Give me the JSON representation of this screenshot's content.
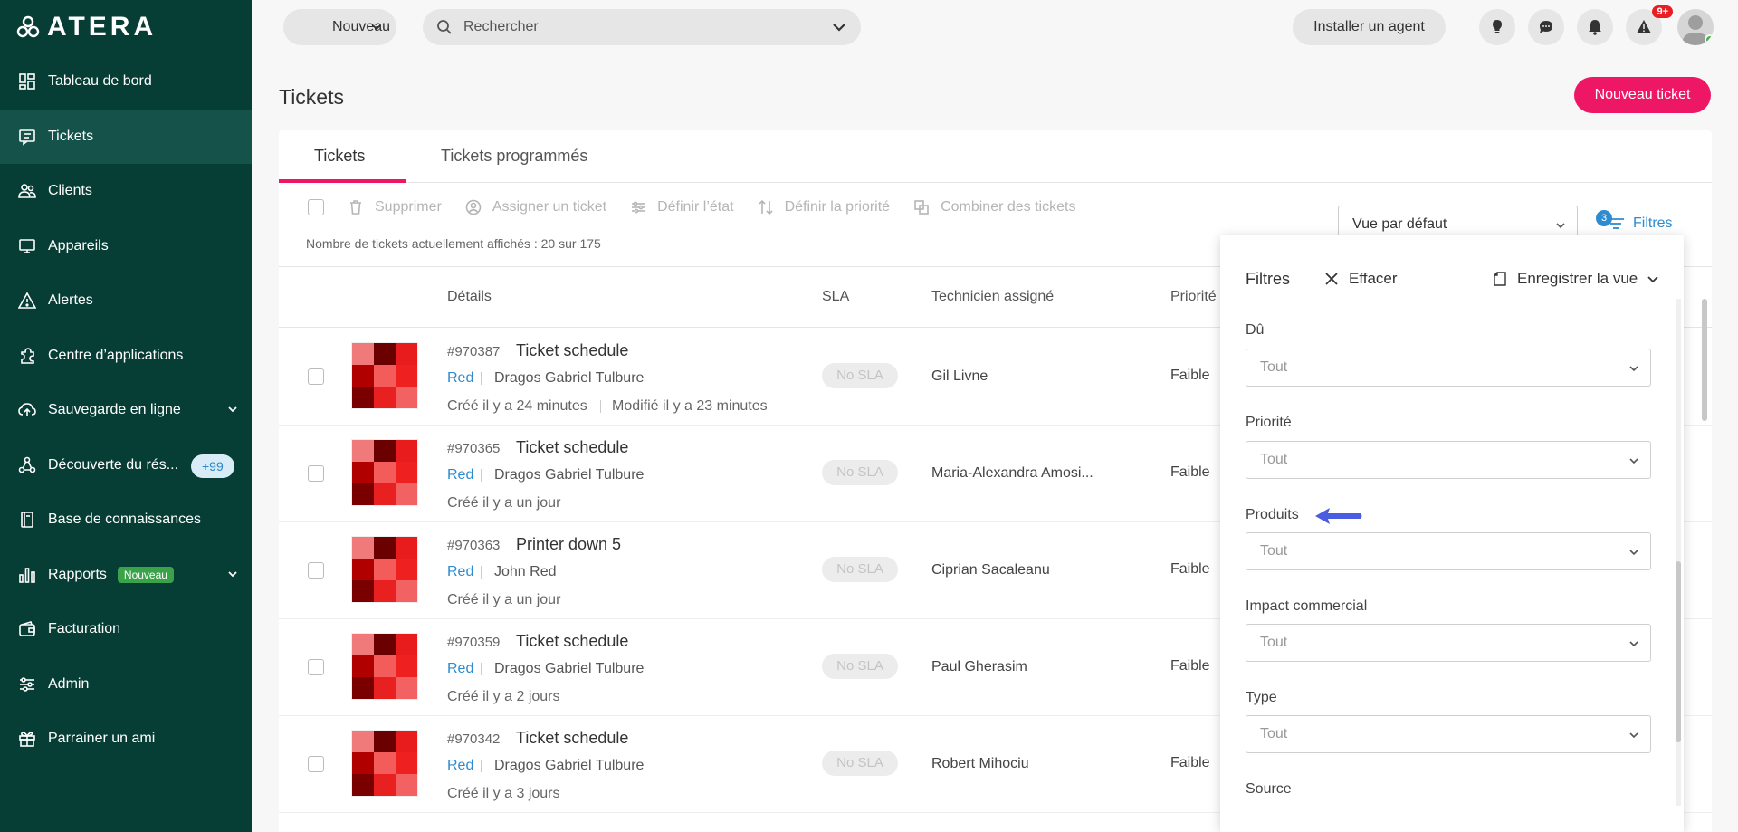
{
  "brand": {
    "logo_text": "ATERA"
  },
  "sidebar": {
    "items": [
      {
        "label": "Tableau de bord",
        "icon": "dashboard-icon"
      },
      {
        "label": "Tickets",
        "icon": "ticket-icon"
      },
      {
        "label": "Clients",
        "icon": "clients-icon"
      },
      {
        "label": "Appareils",
        "icon": "monitor-icon"
      },
      {
        "label": "Alertes",
        "icon": "alert-icon"
      },
      {
        "label": "Centre d’applications",
        "icon": "puzzle-icon"
      },
      {
        "label": "Sauvegarde en ligne",
        "icon": "cloud-icon"
      },
      {
        "label": "Découverte du rés...",
        "icon": "network-icon",
        "badge": "+99"
      },
      {
        "label": "Base de connaissances",
        "icon": "book-icon"
      },
      {
        "label": "Rapports",
        "icon": "chart-icon",
        "badge": "Nouveau"
      },
      {
        "label": "Facturation",
        "icon": "wallet-icon"
      },
      {
        "label": "Admin",
        "icon": "sliders-icon"
      },
      {
        "label": "Parrainer un ami",
        "icon": "gift-icon"
      }
    ]
  },
  "topbar": {
    "new_label": "Nouveau",
    "search_placeholder": "Rechercher",
    "install_label": "Installer un agent",
    "alerts_badge": "9+"
  },
  "page": {
    "title": "Tickets",
    "new_ticket_label": "Nouveau ticket"
  },
  "tabs": [
    {
      "label": "Tickets"
    },
    {
      "label": "Tickets programmés"
    }
  ],
  "toolbar": {
    "delete": "Supprimer",
    "assign": "Assigner un ticket",
    "state": "Définir l’état",
    "priority": "Définir la priorité",
    "combine": "Combiner des tickets",
    "count_text": "Nombre de tickets actuellement affichés : 20 sur 175",
    "view": "Vue par défaut",
    "filters_label": "Filtres",
    "filters_count": "3"
  },
  "table": {
    "headers": {
      "details": "Détails",
      "sla": "SLA",
      "tech": "Technicien assigné",
      "priority": "Priorité"
    },
    "rows": [
      {
        "id": "#970387",
        "title": "Ticket schedule",
        "client": "Red",
        "contact": "Dragos Gabriel Tulbure",
        "created": "Créé il y a 24 minutes",
        "modified": "Modifié il y a 23 minutes",
        "sla": "No SLA",
        "tech": "Gil Livne",
        "priority": "Faible"
      },
      {
        "id": "#970365",
        "title": "Ticket schedule",
        "client": "Red",
        "contact": "Dragos Gabriel Tulbure",
        "created": "Créé il y a un jour",
        "modified": "",
        "sla": "No SLA",
        "tech": "Maria-Alexandra Amosi...",
        "priority": "Faible"
      },
      {
        "id": "#970363",
        "title": "Printer down 5",
        "client": "Red",
        "contact": "John Red",
        "created": "Créé il y a un jour",
        "modified": "",
        "sla": "No SLA",
        "tech": "Ciprian Sacaleanu",
        "priority": "Faible"
      },
      {
        "id": "#970359",
        "title": "Ticket schedule",
        "client": "Red",
        "contact": "Dragos Gabriel Tulbure",
        "created": "Créé il y a 2 jours",
        "modified": "",
        "sla": "No SLA",
        "tech": "Paul Gherasim",
        "priority": "Faible"
      },
      {
        "id": "#970342",
        "title": "Ticket schedule",
        "client": "Red",
        "contact": "Dragos Gabriel Tulbure",
        "created": "Créé il y a 3 jours",
        "modified": "",
        "sla": "No SLA",
        "tech": "Robert Mihociu",
        "priority": "Faible"
      }
    ]
  },
  "filters_panel": {
    "title": "Filtres",
    "clear": "Effacer",
    "save_view": "Enregistrer la vue",
    "fields": [
      {
        "label": "Dû",
        "value": "Tout"
      },
      {
        "label": "Priorité",
        "value": "Tout"
      },
      {
        "label": "Produits",
        "value": "Tout"
      },
      {
        "label": "Impact commercial",
        "value": "Tout"
      },
      {
        "label": "Type",
        "value": "Tout"
      },
      {
        "label": "Source",
        "value": ""
      }
    ]
  },
  "colors": {
    "sidebar_bg": "#063d35",
    "accent_pink": "#ee1765",
    "link_blue": "#2d8bd0",
    "arrow_blue": "#4a5de0"
  }
}
